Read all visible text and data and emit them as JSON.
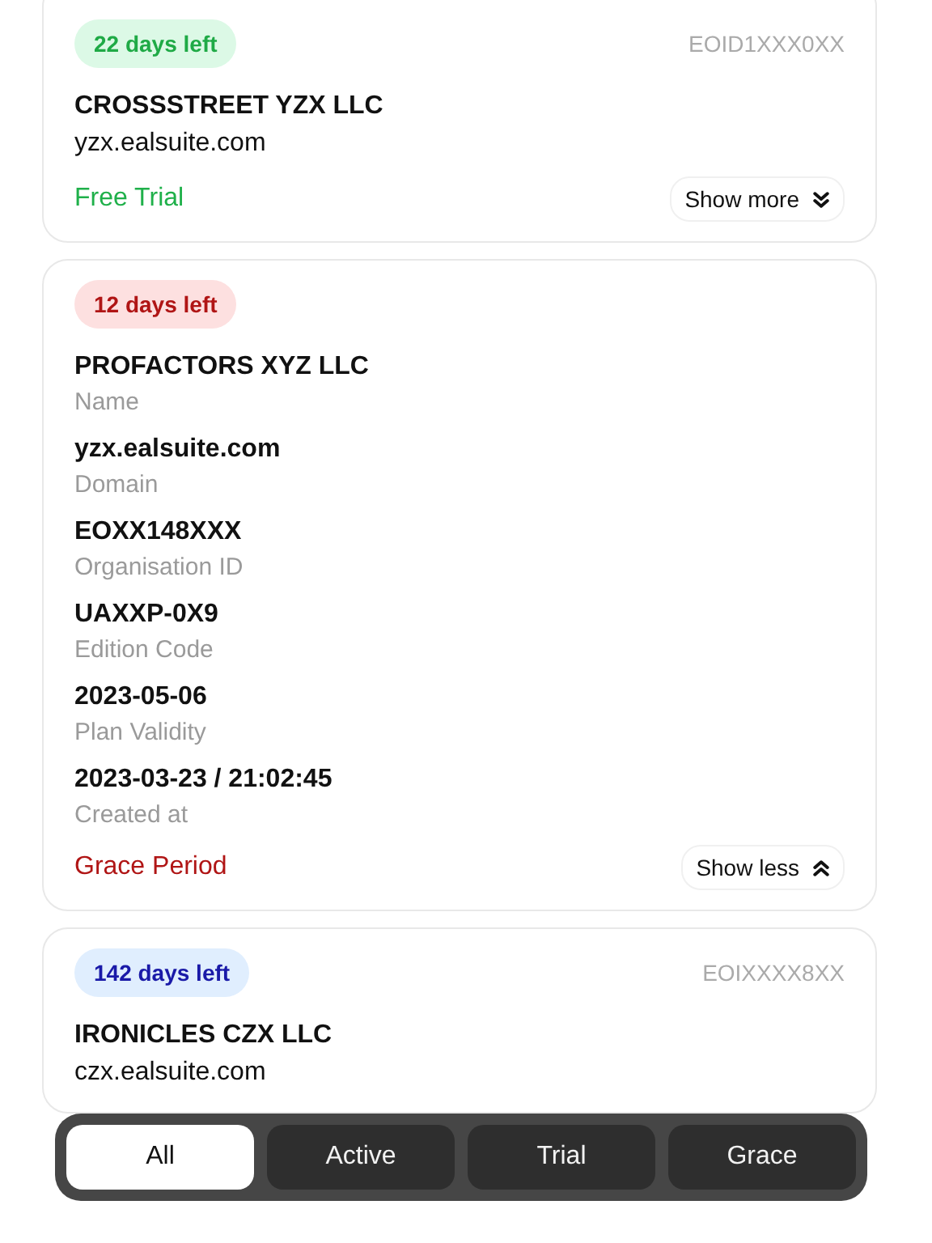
{
  "accounts": [
    {
      "badge": "22 days left",
      "kind": "trial",
      "org_id": "EOID1XXX0XX",
      "expanded": false,
      "name": "CROSSSTREET YZX LLC",
      "domain": "yzx.ealsuite.com",
      "plan": "Free Trial",
      "toggle": "Show more"
    },
    {
      "badge": "12 days left",
      "kind": "grace",
      "expanded": true,
      "fields": [
        {
          "value": "PROFACTORS XYZ LLC",
          "label": "Name"
        },
        {
          "value": "yzx.ealsuite.com",
          "label": "Domain"
        },
        {
          "value": "EOXX148XXX",
          "label": "Organisation ID"
        },
        {
          "value": "UAXXP-0X9",
          "label": "Edition Code"
        },
        {
          "value": "2023-05-06",
          "label": "Plan Validity"
        },
        {
          "value": "2023-03-23 / 21:02:45",
          "label": "Created at"
        }
      ],
      "plan": "Grace Period",
      "toggle": "Show less"
    },
    {
      "badge": "142 days left",
      "kind": "active",
      "org_id": "EOIXXXX8XX",
      "expanded": false,
      "name": "IRONICLES CZX LLC",
      "domain": "czx.ealsuite.com"
    }
  ],
  "filters": [
    {
      "label": "All",
      "selected": true
    },
    {
      "label": "Active",
      "selected": false
    },
    {
      "label": "Trial",
      "selected": false
    },
    {
      "label": "Grace",
      "selected": false
    }
  ]
}
